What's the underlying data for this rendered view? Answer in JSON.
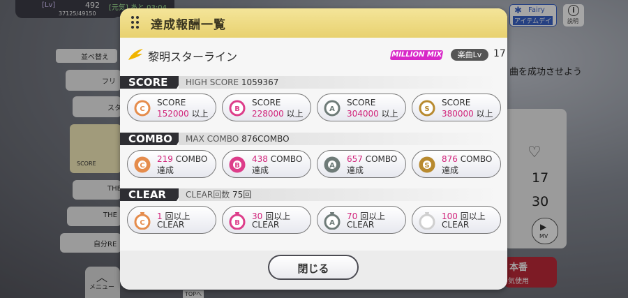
{
  "status": {
    "lv_label": "[Lv]",
    "lv_value": "492",
    "exp": "37125/49150",
    "genki_label": "[元気] あと 03:04"
  },
  "top_right": {
    "fairy_label": "Fairy",
    "item_day_label": "アイテムデイ",
    "info_label": "説明"
  },
  "background": {
    "sort_label": "並べ替え",
    "mission_text": "曲を成功させよう",
    "num_17": "17",
    "num_30": "30",
    "mv_label": "MV",
    "honban_label": "本番",
    "genki_use": "気使用",
    "menu_label": "メニュー",
    "topen_label": "TOPへ",
    "score_label": "SCORE",
    "list_items": [
      "フリ",
      "スタ",
      "THE",
      "THE",
      "自分RE"
    ]
  },
  "modal": {
    "title": "達成報酬一覧",
    "song_title": "黎明スターライン",
    "mm_badge": "MILLION MIX",
    "lv_label": "楽曲Lv",
    "lv_value": "17",
    "score": {
      "label": "SCORE",
      "info_label": "HIGH SCORE",
      "info_value": "1059367",
      "items": [
        {
          "rank": "C",
          "line1": "SCORE",
          "value": "152000",
          "suffix": "以上",
          "color": "#e58c4c"
        },
        {
          "rank": "B",
          "line1": "SCORE",
          "value": "228000",
          "suffix": "以上",
          "color": "#dd3d8a"
        },
        {
          "rank": "A",
          "line1": "SCORE",
          "value": "304000",
          "suffix": "以上",
          "color": "#6e7b78"
        },
        {
          "rank": "S",
          "line1": "SCORE",
          "value": "380000",
          "suffix": "以上",
          "color": "#b88a2f"
        }
      ]
    },
    "combo": {
      "label": "COMBO",
      "info_label": "MAX COMBO",
      "info_value": "876COMBO",
      "items": [
        {
          "rank": "C",
          "value": "219",
          "unit": "COMBO",
          "line2": "達成",
          "color": "#e58c4c"
        },
        {
          "rank": "B",
          "value": "438",
          "unit": "COMBO",
          "line2": "達成",
          "color": "#dd3d8a"
        },
        {
          "rank": "A",
          "value": "657",
          "unit": "COMBO",
          "line2": "達成",
          "color": "#6e7b78"
        },
        {
          "rank": "S",
          "value": "876",
          "unit": "COMBO",
          "line2": "達成",
          "color": "#b88a2f"
        }
      ]
    },
    "clear": {
      "label": "CLEAR",
      "info_label": "CLEAR回数",
      "info_value": "75回",
      "items": [
        {
          "rank": "C",
          "value": "1",
          "unit": "回以上",
          "line2": "CLEAR",
          "color": "#e58c4c"
        },
        {
          "rank": "B",
          "value": "30",
          "unit": "回以上",
          "line2": "CLEAR",
          "color": "#dd3d8a"
        },
        {
          "rank": "A",
          "value": "70",
          "unit": "回以上",
          "line2": "CLEAR",
          "color": "#6e7b78"
        },
        {
          "rank": "",
          "value": "100",
          "unit": "回以上",
          "line2": "CLEAR",
          "color": "#cfcfcf"
        }
      ]
    },
    "close_label": "閉じる"
  }
}
